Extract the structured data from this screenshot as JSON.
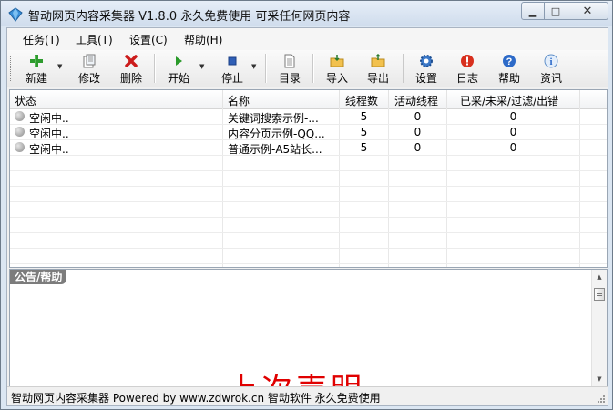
{
  "window": {
    "title": "智动网页内容采集器 V1.8.0 永久免费使用 可采任何网页内容"
  },
  "menu": [
    "任务(T)",
    "工具(T)",
    "设置(C)",
    "帮助(H)"
  ],
  "toolbar": {
    "new": "新建",
    "edit": "修改",
    "delete": "删除",
    "start": "开始",
    "stop": "停止",
    "catalog": "目录",
    "import": "导入",
    "export": "导出",
    "settings": "设置",
    "log": "日志",
    "help": "帮助",
    "news": "资讯"
  },
  "table": {
    "headers": [
      "状态",
      "名称",
      "线程数",
      "活动线程",
      "已采/未采/过滤/出错"
    ],
    "rows": [
      {
        "status": "空闲中..",
        "name": "关键词搜索示例-...",
        "threads": "5",
        "active": "0",
        "stats": "0"
      },
      {
        "status": "空闲中..",
        "name": "内容分页示例-QQ...",
        "threads": "5",
        "active": "0",
        "stats": "0"
      },
      {
        "status": "空闲中..",
        "name": "普通示例-A5站长...",
        "threads": "5",
        "active": "0",
        "stats": "0"
      }
    ]
  },
  "panel": {
    "tab": "公告/帮助",
    "banner": "上次声明"
  },
  "status": "智动网页内容采集器 Powered by www.zdwrok.cn 智动软件 永久免费使用",
  "colors": {
    "banner_red": "#e00000",
    "panel_tab": "#7c7c7c"
  }
}
